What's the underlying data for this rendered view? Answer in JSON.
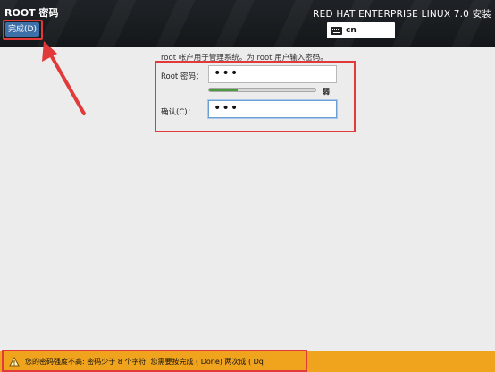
{
  "header": {
    "title": "ROOT 密码",
    "done_label": "完成(D)",
    "product": "RED HAT ENTERPRISE LINUX 7.0 安装",
    "keyboard_layout": "cn"
  },
  "form": {
    "description": "root 帐户用于管理系统。为 root 用户输入密码。",
    "root_password_label": "Root 密码：",
    "root_password_value": "•••",
    "strength_fraction": 0.27,
    "strength_label": "弱",
    "confirm_label": "确认(C)：",
    "confirm_value": "•••"
  },
  "status": {
    "message": "您的密码强度不高: 密码少于 8 个字符. 您需要按完成 ( Done) 两次成 ( Dq",
    "color": "#f0a41e"
  },
  "icons": [
    "keyboard-icon",
    "warning-icon",
    "annotation-arrow"
  ],
  "accent": "#3d6fa8",
  "annotation_color": "#e03a3a"
}
